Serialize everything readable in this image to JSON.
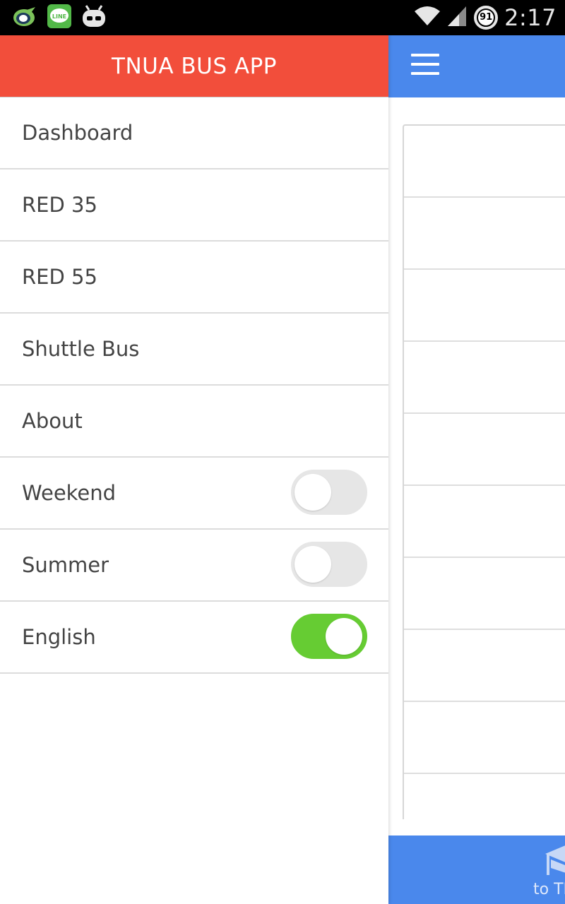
{
  "status_bar": {
    "time": "2:17",
    "battery_level": "91",
    "icons": [
      "chat-app-icon",
      "line-app-icon",
      "android-robot-icon",
      "wifi-icon",
      "signal-icon",
      "battery-icon"
    ]
  },
  "drawer": {
    "title": "TNUA BUS APP",
    "header_color": "#f24e3b",
    "items": [
      {
        "label": "Dashboard"
      },
      {
        "label": "RED 35"
      },
      {
        "label": "RED 55"
      },
      {
        "label": "Shuttle Bus"
      },
      {
        "label": "About"
      }
    ],
    "toggles": [
      {
        "label": "Weekend",
        "on": false
      },
      {
        "label": "Summer",
        "on": false
      },
      {
        "label": "English",
        "on": true
      }
    ]
  },
  "main": {
    "header_color": "#4a88ec",
    "menu_icon": "hamburger-menu-icon",
    "bottom_tab_label": "to TN",
    "bottom_tab_icon": "graduation-cap-icon"
  },
  "colors": {
    "toggle_on": "#66cc33",
    "toggle_off": "#e6e6e6",
    "accent_blue": "#4a88ec",
    "accent_red": "#f24e3b"
  }
}
